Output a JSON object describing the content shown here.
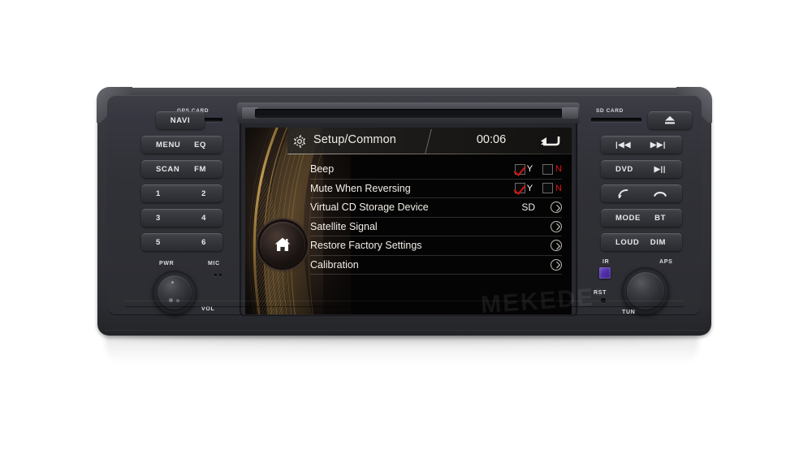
{
  "device": {
    "brand_watermark": "MEKEDE",
    "watermark_mark": "®"
  },
  "left_panel": {
    "gps_card_label": "GPS CARD",
    "buttons": [
      {
        "name": "navi",
        "left": "NAVI",
        "right": ""
      },
      {
        "name": "menu-eq",
        "left": "MENU",
        "right": "EQ"
      },
      {
        "name": "scan-fm",
        "left": "SCAN",
        "right": "FM"
      },
      {
        "name": "preset-1-2",
        "left": "1",
        "right": "2"
      },
      {
        "name": "preset-3-4",
        "left": "3",
        "right": "4"
      },
      {
        "name": "preset-5-6",
        "left": "5",
        "right": "6"
      }
    ],
    "pwr_label": "PWR",
    "vol_label": "VOL",
    "mic_label": "MIC"
  },
  "right_panel": {
    "sd_card_label": "SD CARD",
    "eject_label": "eject-icon",
    "buttons": [
      {
        "name": "track-prev-next",
        "left": "|◀◀",
        "right": "▶▶|"
      },
      {
        "name": "dvd-playpause",
        "left": "DVD",
        "right": "▶||"
      },
      {
        "name": "call-hangup",
        "left": "call-answer-icon",
        "right": "call-end-icon"
      },
      {
        "name": "mode-bt",
        "left": "MODE",
        "right": "BT"
      },
      {
        "name": "loud-dim",
        "left": "LOUD",
        "right": "DIM"
      }
    ],
    "ir_label": "IR",
    "rst_label": "RST",
    "aps_label": "APS",
    "tun_label": "TUN"
  },
  "screen": {
    "header": {
      "icon": "gear-icon",
      "title": "Setup/Common",
      "time": "00:06",
      "back_icon": "back-arrow-icon"
    },
    "home_button": "home-icon",
    "rows": [
      {
        "label": "Beep",
        "type": "yesno",
        "yes_label": "Y",
        "no_label": "N",
        "yes_checked": true,
        "no_checked": false,
        "value": ""
      },
      {
        "label": "Mute When Reversing",
        "type": "yesno",
        "yes_label": "Y",
        "no_label": "N",
        "yes_checked": true,
        "no_checked": false,
        "value": ""
      },
      {
        "label": "Virtual CD Storage Device",
        "type": "value-chevron",
        "value": "SD"
      },
      {
        "label": "Satellite Signal",
        "type": "chevron",
        "value": ""
      },
      {
        "label": "Restore Factory Settings",
        "type": "chevron",
        "value": ""
      },
      {
        "label": "Calibration",
        "type": "chevron",
        "value": ""
      }
    ]
  },
  "colors": {
    "accent_red": "#d41414",
    "screen_text": "#f2efe9",
    "bronze": "#b08a4a",
    "ir_purple": "#4e2ea8",
    "chassis": "#303136"
  }
}
